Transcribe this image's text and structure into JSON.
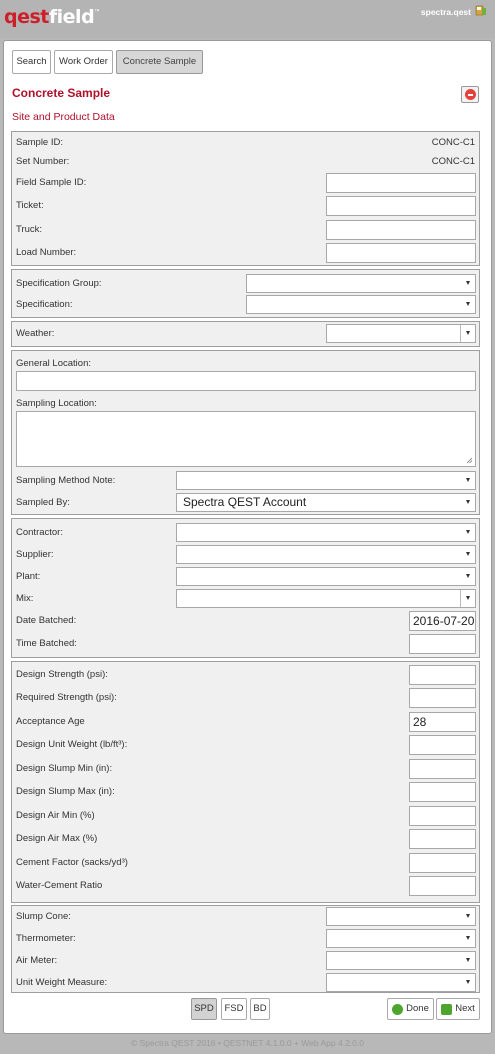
{
  "header": {
    "logo_q": "qest",
    "logo_f": "field",
    "logo_tm": "™",
    "user": "spectra.qest",
    "user_icon": "user-flag-icon"
  },
  "tabs": [
    "Search",
    "Work Order",
    "Concrete Sample"
  ],
  "page": {
    "title": "Concrete Sample",
    "close_icon": "remove-icon",
    "section": "Site and Product Data"
  },
  "sample": {
    "sample_id_label": "Sample ID:",
    "sample_id": "CONC-C1",
    "set_number_label": "Set Number:",
    "set_number": "CONC-C1",
    "field_sample_id_label": "Field Sample ID:",
    "ticket_label": "Ticket:",
    "truck_label": "Truck:",
    "load_number_label": "Load Number:"
  },
  "spec": {
    "group_label": "Specification Group:",
    "spec_label": "Specification:"
  },
  "weather": {
    "label": "Weather:"
  },
  "location": {
    "general_label": "General Location:",
    "sampling_label": "Sampling Location:",
    "method_note_label": "Sampling Method Note:",
    "sampled_by_label": "Sampled By:",
    "sampled_by_value": "Spectra QEST Account"
  },
  "supply": {
    "contractor_label": "Contractor:",
    "supplier_label": "Supplier:",
    "plant_label": "Plant:",
    "mix_label": "Mix:",
    "date_batched_label": "Date Batched:",
    "date_batched": "2016-07-20",
    "time_batched_label": "Time Batched:"
  },
  "design": {
    "strength_label": "Design Strength (psi):",
    "required_label": "Required Strength (psi):",
    "acceptance_label": "Acceptance Age",
    "acceptance": "28",
    "unit_weight_label": "Design Unit Weight (lb/ft³):",
    "slump_min_label": "Design Slump Min (in):",
    "slump_max_label": "Design Slump Max (in):",
    "air_min_label": "Design Air Min (%)",
    "air_max_label": "Design Air Max (%)",
    "cement_label": "Cement Factor (sacks/yd³)",
    "wc_label": "Water-Cement Ratio"
  },
  "equipment": {
    "slump_cone_label": "Slump Cone:",
    "thermometer_label": "Thermometer:",
    "air_meter_label": "Air Meter:",
    "unit_weight_measure_label": "Unit Weight Measure:"
  },
  "bottom": {
    "spd": "SPD",
    "fsd": "FSD",
    "bd": "BD",
    "done": "Done",
    "next": "Next"
  },
  "footer": "© Spectra QEST 2016   •   QESTNET 4.1.0.0 + Web App 4.2.0.0",
  "colors": {
    "accent": "#b0102a",
    "logo_red": "#cc1f2a",
    "ok_green": "#4da42f"
  }
}
